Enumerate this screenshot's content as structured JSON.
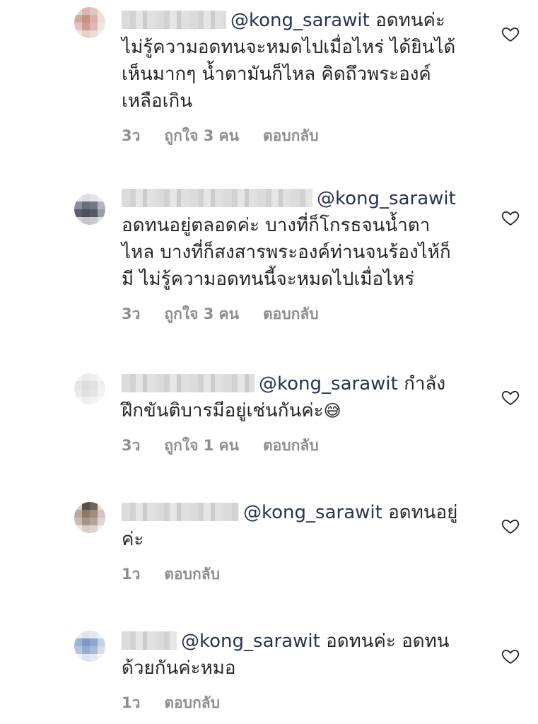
{
  "comments": [
    {
      "mention": "@kong_sarawit",
      "text": " อดทนค่ะ ไม่รู้ความอดทนจะหมดไปเมื่อไหร่ ได้ยินได้เห็นมากๆ น้ำตามันก็ไหล คิดถึวพระองค์เหลือเกิน",
      "time": "3ว",
      "likes": "ถูกใจ 3 คน",
      "reply": "ตอบกลับ"
    },
    {
      "mention": "@kong_sarawit",
      "text": " อดทนอยู่ตลอดค่ะ บางที่ก็โกรธจนน้ำตาไหล บางที่ก็สงสารพระองค์ท่านจนร้องไห้ก็มี ไม่รู้ความอดทนนี้จะหมดไปเมื่อไหร่",
      "time": "3ว",
      "likes": "ถูกใจ 3 คน",
      "reply": "ตอบกลับ"
    },
    {
      "mention": "@kong_sarawit",
      "text": " กำลังฝึกขันติบารมีอยู่เช่นกันค่ะ",
      "emoji": "😅",
      "time": "3ว",
      "likes": "ถูกใจ 1 คน",
      "reply": "ตอบกลับ"
    },
    {
      "mention": "@kong_sarawit",
      "text": " อดทนอยู่ค่ะ",
      "time": "1ว",
      "reply": "ตอบกลับ"
    },
    {
      "mention": "@kong_sarawit",
      "text": " อดทนค่ะ อดทนด้วยกันค่ะหมอ",
      "time": "1ว",
      "reply": "ตอบกลับ"
    }
  ],
  "colors": {
    "mention": "#28344f",
    "meta": "#8e8e8e",
    "text": "#262626"
  },
  "icons": {
    "like": "heart-outline-icon"
  }
}
